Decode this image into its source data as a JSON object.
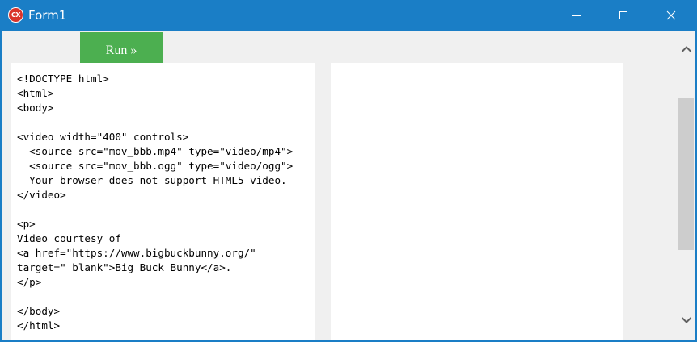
{
  "window": {
    "title": "Form1",
    "icon_label": "CX",
    "icon_color": "#d9342b",
    "titlebar_color": "#1a7ec6"
  },
  "toolbar": {
    "run_label": "Run »",
    "run_color": "#4caf50"
  },
  "editor": {
    "lines": [
      "<!DOCTYPE html>",
      "<html>",
      "<body>",
      "",
      "<video width=\"400\" controls>",
      "  <source src=\"mov_bbb.mp4\" type=\"video/mp4\">",
      "  <source src=\"mov_bbb.ogg\" type=\"video/ogg\">",
      "  Your browser does not support HTML5 video.",
      "</video>",
      "",
      "<p>",
      "Video courtesy of",
      "<a href=\"https://www.bigbuckbunny.org/\"",
      "target=\"_blank\">Big Buck Bunny</a>.",
      "</p>",
      "",
      "</body>",
      "</html>"
    ]
  },
  "icons": {
    "app": "cx-logo-icon",
    "minimize": "minimize-icon",
    "maximize": "maximize-icon",
    "close": "close-icon",
    "scroll_up": "chevron-up-icon",
    "scroll_down": "chevron-down-icon"
  }
}
